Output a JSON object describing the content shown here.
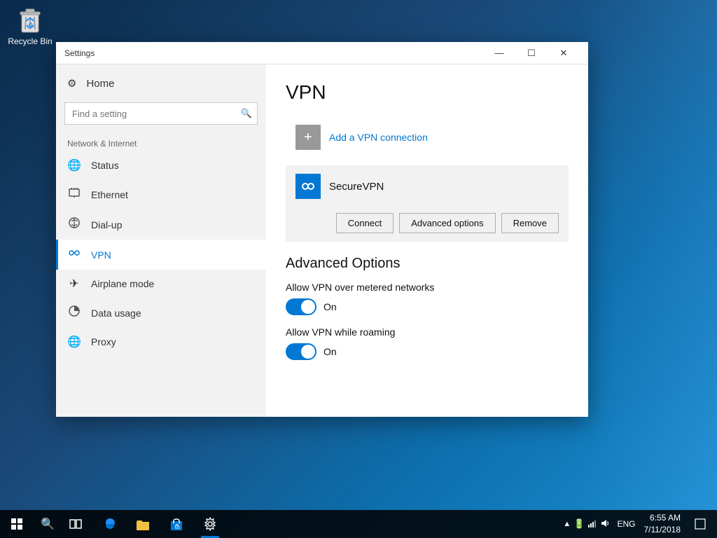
{
  "desktop": {
    "recycle_bin_label": "Recycle Bin"
  },
  "window": {
    "title": "Settings",
    "controls": {
      "minimize": "—",
      "maximize": "☐",
      "close": "✕"
    }
  },
  "sidebar": {
    "home_label": "Home",
    "search_placeholder": "Find a setting",
    "section_label": "Network & Internet",
    "items": [
      {
        "id": "status",
        "label": "Status",
        "icon": "🌐"
      },
      {
        "id": "ethernet",
        "label": "Ethernet",
        "icon": "🖥"
      },
      {
        "id": "dialup",
        "label": "Dial-up",
        "icon": "📞"
      },
      {
        "id": "vpn",
        "label": "VPN",
        "icon": "🔗",
        "active": true
      },
      {
        "id": "airplane",
        "label": "Airplane mode",
        "icon": "✈"
      },
      {
        "id": "datausage",
        "label": "Data usage",
        "icon": "📊"
      },
      {
        "id": "proxy",
        "label": "Proxy",
        "icon": "🌐"
      }
    ]
  },
  "main": {
    "page_title": "VPN",
    "add_vpn_label": "Add a VPN connection",
    "vpn_item": {
      "name": "SecureVPN",
      "connect_btn": "Connect",
      "advanced_btn": "Advanced options",
      "remove_btn": "Remove"
    },
    "advanced_options_title": "Advanced Options",
    "toggle1": {
      "label": "Allow VPN over metered networks",
      "state": "On"
    },
    "toggle2": {
      "label": "Allow VPN while roaming",
      "state": "On"
    }
  },
  "taskbar": {
    "start_icon": "⊞",
    "search_icon": "🔍",
    "task_view_icon": "❑",
    "app_icons": [
      "e",
      "📁",
      "🛍",
      "⚙"
    ],
    "sys_icons": [
      "▲",
      "🔋",
      "📶",
      "🔊"
    ],
    "language": "ENG",
    "time": "6:55 AM",
    "date": "7/11/2018",
    "notification_icon": "🔔"
  }
}
